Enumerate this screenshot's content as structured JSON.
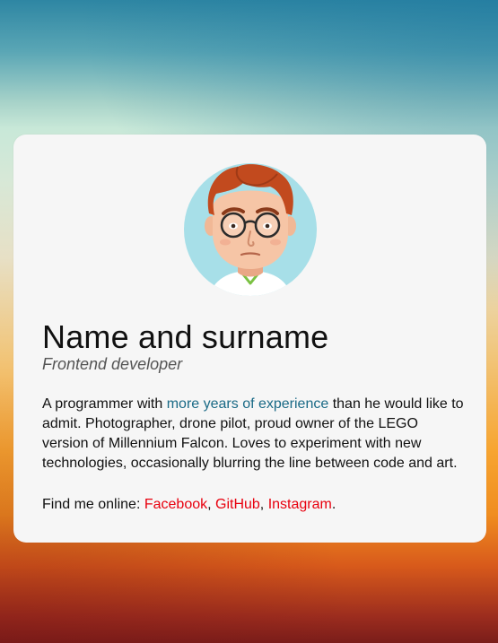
{
  "profile": {
    "avatar_alt": "cartoon avatar",
    "name": "Name and surname",
    "role": "Frontend developer"
  },
  "bio": {
    "part1": "A programmer with ",
    "experience_link": "more years of experience",
    "part2": " than he would like to admit. Photographer, drone pilot, proud owner of the LEGO version of Millennium Falcon. Loves to experiment with new technologies, occasionally blurring the line between code and art."
  },
  "social": {
    "prefix": "Find me online: ",
    "sep1": ", ",
    "sep2": ", ",
    "suffix": ".",
    "links": [
      {
        "label": "Facebook"
      },
      {
        "label": "GitHub"
      },
      {
        "label": "Instagram"
      }
    ]
  },
  "colors": {
    "link_primary": "#1a6a86",
    "link_social": "#e8000e",
    "card_bg": "#f6f6f6"
  }
}
